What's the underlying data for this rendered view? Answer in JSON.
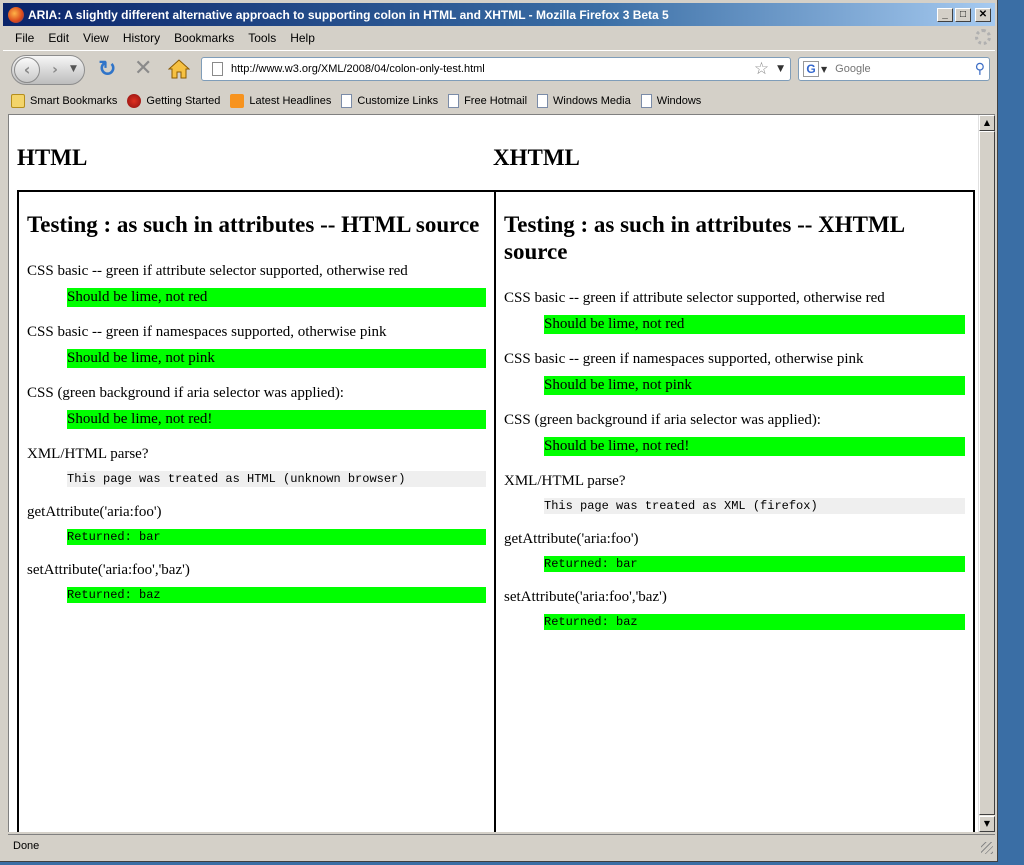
{
  "window": {
    "title": "ARIA: A slightly different alternative approach to supporting colon in HTML and XHTML - Mozilla Firefox 3 Beta 5"
  },
  "menu": [
    "File",
    "Edit",
    "View",
    "History",
    "Bookmarks",
    "Tools",
    "Help"
  ],
  "nav": {
    "url": "http://www.w3.org/XML/2008/04/colon-only-test.html",
    "search_placeholder": "Google"
  },
  "bookmarks": [
    {
      "label": "Smart Bookmarks",
      "icon": "folder-icon"
    },
    {
      "label": "Getting Started",
      "icon": "getting-started-icon"
    },
    {
      "label": "Latest Headlines",
      "icon": "rss-icon"
    },
    {
      "label": "Customize Links",
      "icon": "page-icon"
    },
    {
      "label": "Free Hotmail",
      "icon": "page-icon"
    },
    {
      "label": "Windows Media",
      "icon": "page-icon"
    },
    {
      "label": "Windows",
      "icon": "page-icon"
    }
  ],
  "page": {
    "left": {
      "heading": "HTML",
      "section_title": "Testing : as such in attributes -- HTML source",
      "tests": [
        {
          "label": "CSS basic -- green if attribute selector supported, otherwise red",
          "result": "Should be lime, not red",
          "mono": false,
          "color": "#00ff00"
        },
        {
          "label": "CSS basic -- green if namespaces supported, otherwise pink",
          "result": "Should be lime, not pink",
          "mono": false,
          "color": "#00ff00"
        },
        {
          "label": "CSS (green background if aria selector was applied):",
          "result": "Should be lime, not red!",
          "mono": false,
          "color": "#00ff00"
        },
        {
          "label": "XML/HTML parse?",
          "result": "This page was treated as HTML (unknown browser)",
          "mono": true,
          "color": "#efefef"
        },
        {
          "label": "getAttribute('aria:foo')",
          "result": "Returned: bar",
          "mono": true,
          "color": "#00ff00"
        },
        {
          "label": "setAttribute('aria:foo','baz')",
          "result": "Returned: baz",
          "mono": true,
          "color": "#00ff00"
        }
      ]
    },
    "right": {
      "heading": "XHTML",
      "section_title": "Testing : as such in attributes -- XHTML source",
      "tests": [
        {
          "label": "CSS basic -- green if attribute selector supported, otherwise red",
          "result": "Should be lime, not red",
          "mono": false,
          "color": "#00ff00"
        },
        {
          "label": "CSS basic -- green if namespaces supported, otherwise pink",
          "result": "Should be lime, not pink",
          "mono": false,
          "color": "#00ff00"
        },
        {
          "label": "CSS (green background if aria selector was applied):",
          "result": "Should be lime, not red!",
          "mono": false,
          "color": "#00ff00"
        },
        {
          "label": "XML/HTML parse?",
          "result": "This page was treated as XML (firefox)",
          "mono": true,
          "color": "#efefef"
        },
        {
          "label": "getAttribute('aria:foo')",
          "result": "Returned: bar",
          "mono": true,
          "color": "#00ff00"
        },
        {
          "label": "setAttribute('aria:foo','baz')",
          "result": "Returned: baz",
          "mono": true,
          "color": "#00ff00"
        }
      ]
    }
  },
  "status": "Done"
}
